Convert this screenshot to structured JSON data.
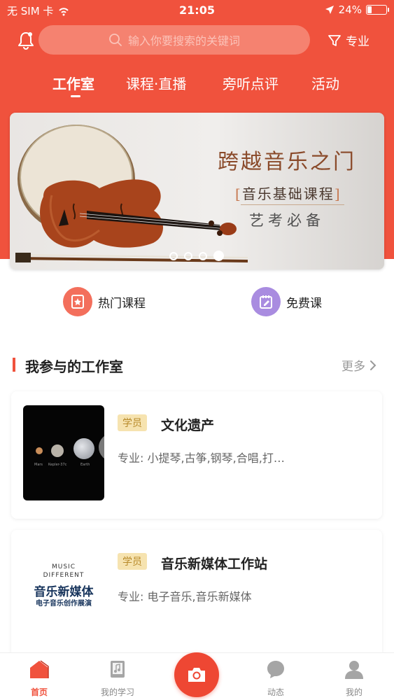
{
  "status_bar": {
    "carrier": "无 SIM 卡",
    "time": "21:05",
    "battery": "24%",
    "battery_level": 0.24
  },
  "search": {
    "placeholder": "输入你要搜索的关键词",
    "filter_label": "专业"
  },
  "tabs": [
    {
      "label": "工作室",
      "active": true
    },
    {
      "label": "课程·直播",
      "active": false
    },
    {
      "label": "旁听点评",
      "active": false
    },
    {
      "label": "活动",
      "active": false
    }
  ],
  "banner": {
    "title": "跨越音乐之门",
    "course": "音乐基础课程",
    "subtitle": "艺考必备",
    "slide_count": 4,
    "active_slide": 4
  },
  "quick_links": [
    {
      "label": "热门课程",
      "icon": "hot-course-icon",
      "color": "#f36f5c"
    },
    {
      "label": "免费课",
      "icon": "free-course-icon",
      "color": "#a98ce0"
    }
  ],
  "section": {
    "title": "我参与的工作室",
    "more": "更多"
  },
  "studios": [
    {
      "badge": "学员",
      "name": "文化遗产",
      "major": "专业: 小提琴,古筝,钢琴,合唱,打…",
      "image_labels": [
        "Mars",
        "Kepler-37c",
        "Earth"
      ]
    },
    {
      "badge": "学员",
      "name": "音乐新媒体工作站",
      "major": "专业: 电子音乐,音乐新媒体",
      "image_en_1": "MUSIC",
      "image_en_2": "DIFFERENT",
      "image_cn": "音乐新媒体",
      "image_sub": "电子音乐创作展演"
    }
  ],
  "bottom_nav": [
    {
      "label": "首页",
      "icon": "home-icon",
      "active": true
    },
    {
      "label": "我的学习",
      "icon": "study-book-icon",
      "active": false
    },
    {
      "label": "",
      "icon": "camera-icon",
      "active": false
    },
    {
      "label": "动态",
      "icon": "chat-bubble-icon",
      "active": false
    },
    {
      "label": "我的",
      "icon": "user-icon",
      "active": false
    }
  ],
  "colors": {
    "brand": "#f0523d",
    "badge_bg": "#f6e3b0",
    "badge_text": "#b88a2a"
  }
}
